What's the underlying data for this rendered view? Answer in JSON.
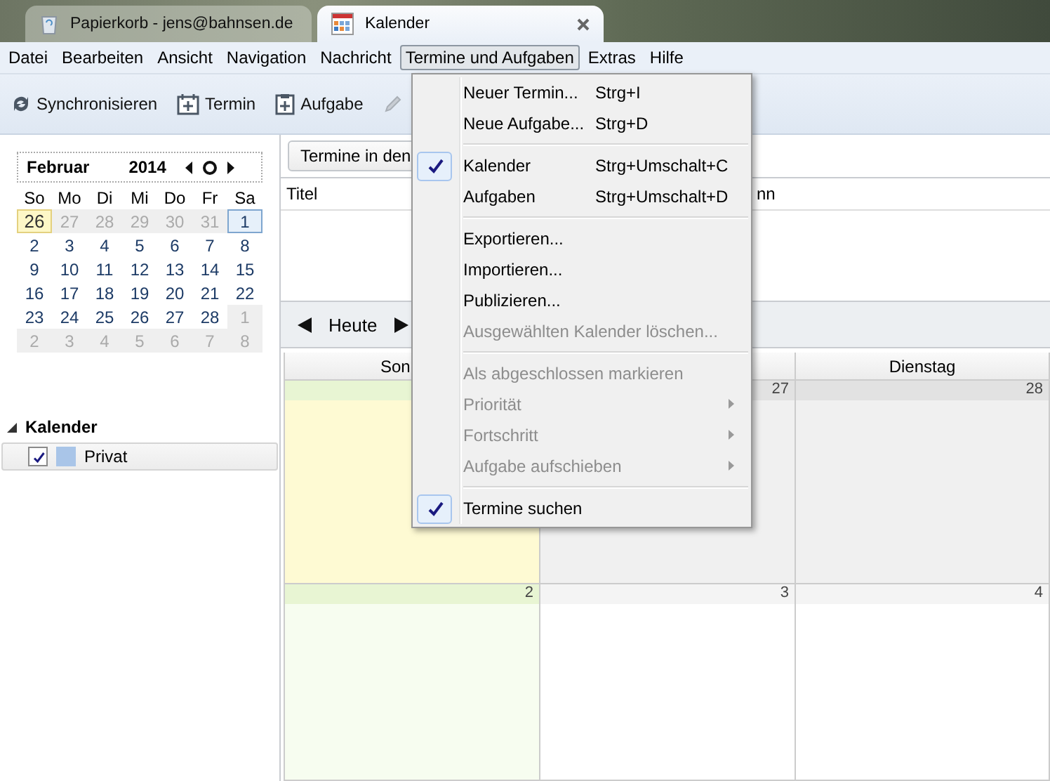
{
  "tabs": [
    {
      "label": "Papierkorb - jens@bahnsen.de",
      "kind": "trash",
      "selected": false
    },
    {
      "label": "Kalender",
      "kind": "calendar",
      "selected": true
    }
  ],
  "menubar": [
    {
      "label": "Datei",
      "selected": false
    },
    {
      "label": "Bearbeiten",
      "selected": false
    },
    {
      "label": "Ansicht",
      "selected": false
    },
    {
      "label": "Navigation",
      "selected": false
    },
    {
      "label": "Nachricht",
      "selected": false
    },
    {
      "label": "Termine und Aufgaben",
      "selected": true
    },
    {
      "label": "Extras",
      "selected": false
    },
    {
      "label": "Hilfe",
      "selected": false
    }
  ],
  "toolbar": [
    {
      "label": "Synchronisieren",
      "kind": "sync"
    },
    {
      "label": "Termin",
      "kind": "event"
    },
    {
      "label": "Aufgabe",
      "kind": "task"
    },
    {
      "kind": "edit"
    }
  ],
  "minimonth": {
    "month": "Februar",
    "year": "2014",
    "weekdays": [
      "So",
      "Mo",
      "Di",
      "Mi",
      "Do",
      "Fr",
      "Sa"
    ],
    "weeks": [
      [
        {
          "day": "26",
          "outside": true,
          "today": true,
          "selected": false
        },
        {
          "day": "27",
          "outside": true,
          "today": false,
          "selected": false
        },
        {
          "day": "28",
          "outside": true,
          "today": false,
          "selected": false
        },
        {
          "day": "29",
          "outside": true,
          "today": false,
          "selected": false
        },
        {
          "day": "30",
          "outside": true,
          "today": false,
          "selected": false
        },
        {
          "day": "31",
          "outside": true,
          "today": false,
          "selected": false
        },
        {
          "day": "1",
          "outside": false,
          "today": false,
          "selected": true
        }
      ],
      [
        {
          "day": "2",
          "outside": false,
          "today": false,
          "selected": false
        },
        {
          "day": "3",
          "outside": false,
          "today": false,
          "selected": false
        },
        {
          "day": "4",
          "outside": false,
          "today": false,
          "selected": false
        },
        {
          "day": "5",
          "outside": false,
          "today": false,
          "selected": false
        },
        {
          "day": "6",
          "outside": false,
          "today": false,
          "selected": false
        },
        {
          "day": "7",
          "outside": false,
          "today": false,
          "selected": false
        },
        {
          "day": "8",
          "outside": false,
          "today": false,
          "selected": false
        }
      ],
      [
        {
          "day": "9",
          "outside": false,
          "today": false,
          "selected": false
        },
        {
          "day": "10",
          "outside": false,
          "today": false,
          "selected": false
        },
        {
          "day": "11",
          "outside": false,
          "today": false,
          "selected": false
        },
        {
          "day": "12",
          "outside": false,
          "today": false,
          "selected": false
        },
        {
          "day": "13",
          "outside": false,
          "today": false,
          "selected": false
        },
        {
          "day": "14",
          "outside": false,
          "today": false,
          "selected": false
        },
        {
          "day": "15",
          "outside": false,
          "today": false,
          "selected": false
        }
      ],
      [
        {
          "day": "16",
          "outside": false,
          "today": false,
          "selected": false
        },
        {
          "day": "17",
          "outside": false,
          "today": false,
          "selected": false
        },
        {
          "day": "18",
          "outside": false,
          "today": false,
          "selected": false
        },
        {
          "day": "19",
          "outside": false,
          "today": false,
          "selected": false
        },
        {
          "day": "20",
          "outside": false,
          "today": false,
          "selected": false
        },
        {
          "day": "21",
          "outside": false,
          "today": false,
          "selected": false
        },
        {
          "day": "22",
          "outside": false,
          "today": false,
          "selected": false
        }
      ],
      [
        {
          "day": "23",
          "outside": false,
          "today": false,
          "selected": false
        },
        {
          "day": "24",
          "outside": false,
          "today": false,
          "selected": false
        },
        {
          "day": "25",
          "outside": false,
          "today": false,
          "selected": false
        },
        {
          "day": "26",
          "outside": false,
          "today": false,
          "selected": false
        },
        {
          "day": "27",
          "outside": false,
          "today": false,
          "selected": false
        },
        {
          "day": "28",
          "outside": false,
          "today": false,
          "selected": false
        },
        {
          "day": "1",
          "outside": true,
          "today": false,
          "selected": false
        }
      ],
      [
        {
          "day": "2",
          "outside": true,
          "today": false,
          "selected": false
        },
        {
          "day": "3",
          "outside": true,
          "today": false,
          "selected": false
        },
        {
          "day": "4",
          "outside": true,
          "today": false,
          "selected": false
        },
        {
          "day": "5",
          "outside": true,
          "today": false,
          "selected": false
        },
        {
          "day": "6",
          "outside": true,
          "today": false,
          "selected": false
        },
        {
          "day": "7",
          "outside": true,
          "today": false,
          "selected": false
        },
        {
          "day": "8",
          "outside": true,
          "today": false,
          "selected": false
        }
      ]
    ]
  },
  "calendars": {
    "title": "Kalender",
    "expanded": true,
    "items": [
      {
        "name": "Privat",
        "checked": true,
        "color": "#a9c5e8"
      }
    ]
  },
  "filter_button": "Termine in den",
  "list_columns": [
    {
      "label": "Titel"
    },
    {
      "label": "nn"
    }
  ],
  "nav": {
    "today": "Heute"
  },
  "view": {
    "columns": [
      {
        "label": "Son"
      },
      {},
      {
        "label": "Dienstag"
      }
    ],
    "weeks": [
      [
        {
          "today": true,
          "outside": true,
          "weekend": true
        },
        {
          "date": "27",
          "today": false,
          "outside": true,
          "weekend": false
        },
        {
          "date": "28",
          "today": false,
          "outside": true,
          "weekend": false
        }
      ],
      [
        {
          "date": "2",
          "today": false,
          "outside": false,
          "weekend": true
        },
        {
          "date": "3",
          "today": false,
          "outside": false,
          "weekend": false
        },
        {
          "date": "4",
          "today": false,
          "outside": false,
          "weekend": false
        }
      ]
    ]
  },
  "menu": [
    {
      "kind": "item",
      "label": "Neuer Termin...",
      "shortcut": "Strg+I",
      "checked": false,
      "disabled": false,
      "submenu": false
    },
    {
      "kind": "item",
      "label": "Neue Aufgabe...",
      "shortcut": "Strg+D",
      "checked": false,
      "disabled": false,
      "submenu": false
    },
    {
      "kind": "separator"
    },
    {
      "kind": "item",
      "label": "Kalender",
      "shortcut": "Strg+Umschalt+C",
      "checked": true,
      "disabled": false,
      "submenu": false
    },
    {
      "kind": "item",
      "label": "Aufgaben",
      "shortcut": "Strg+Umschalt+D",
      "checked": false,
      "disabled": false,
      "submenu": false
    },
    {
      "kind": "separator"
    },
    {
      "kind": "item",
      "label": "Exportieren...",
      "checked": false,
      "disabled": false,
      "submenu": false
    },
    {
      "kind": "item",
      "label": "Importieren...",
      "checked": false,
      "disabled": false,
      "submenu": false
    },
    {
      "kind": "item",
      "label": "Publizieren...",
      "checked": false,
      "disabled": false,
      "submenu": false
    },
    {
      "kind": "item",
      "label": "Ausgewählten Kalender löschen...",
      "checked": false,
      "disabled": true,
      "submenu": false
    },
    {
      "kind": "separator"
    },
    {
      "kind": "item",
      "label": "Als abgeschlossen markieren",
      "checked": false,
      "disabled": true,
      "submenu": false
    },
    {
      "kind": "item",
      "label": "Priorität",
      "checked": false,
      "disabled": true,
      "submenu": true
    },
    {
      "kind": "item",
      "label": "Fortschritt",
      "checked": false,
      "disabled": true,
      "submenu": true
    },
    {
      "kind": "item",
      "label": "Aufgabe aufschieben",
      "checked": false,
      "disabled": true,
      "submenu": true
    },
    {
      "kind": "separator"
    },
    {
      "kind": "item",
      "label": "Termine suchen",
      "checked": true,
      "disabled": false,
      "submenu": false
    }
  ]
}
